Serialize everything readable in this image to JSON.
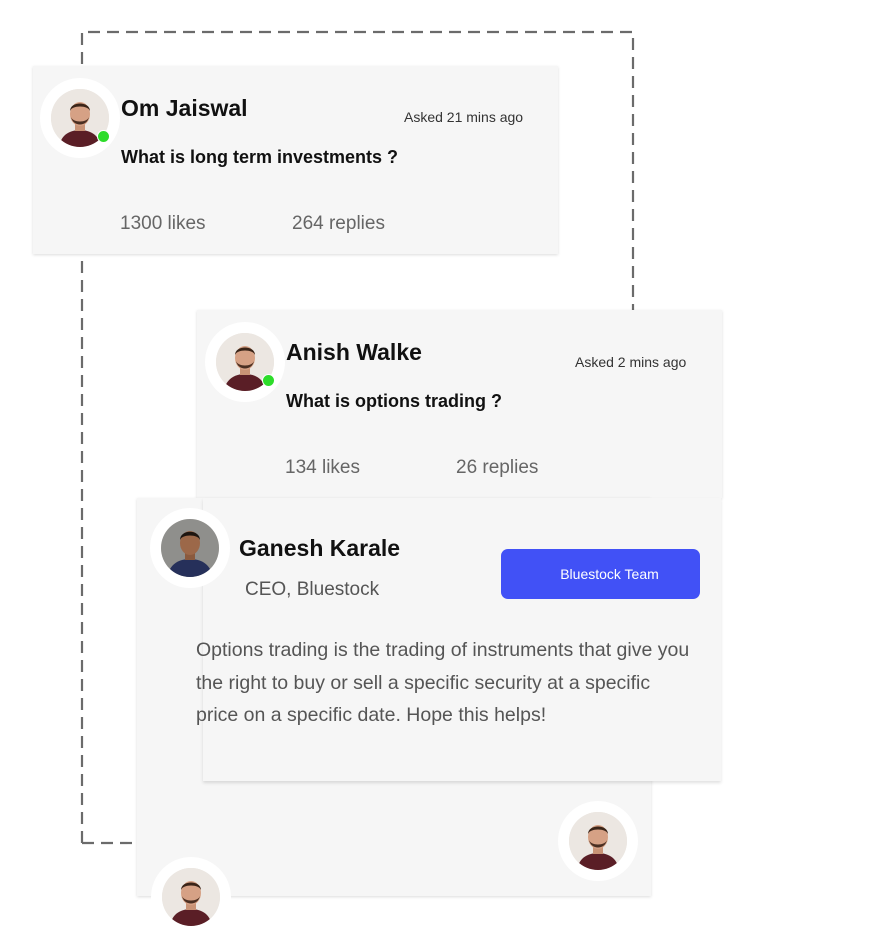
{
  "posts": [
    {
      "name": "Om Jaiswal",
      "asked": "Asked 21 mins ago",
      "question": "What is long term investments ?",
      "likes": "1300 likes",
      "replies": "264 replies",
      "online": true
    },
    {
      "name": "Anish Walke",
      "asked": "Asked 2 mins ago",
      "question": "What is options trading ?",
      "likes": "134 likes",
      "replies": "26 replies",
      "online": true
    }
  ],
  "answer": {
    "name": "Ganesh Karale",
    "role": "CEO, Bluestock",
    "badge": "Bluestock Team",
    "text": "Options trading is the trading of instruments that give you the right to buy or sell a specific security at a specific price on a specific date. Hope this helps!"
  },
  "colors": {
    "accent": "#4151f6",
    "online": "#2ddc2a",
    "card": "#f6f6f6"
  }
}
